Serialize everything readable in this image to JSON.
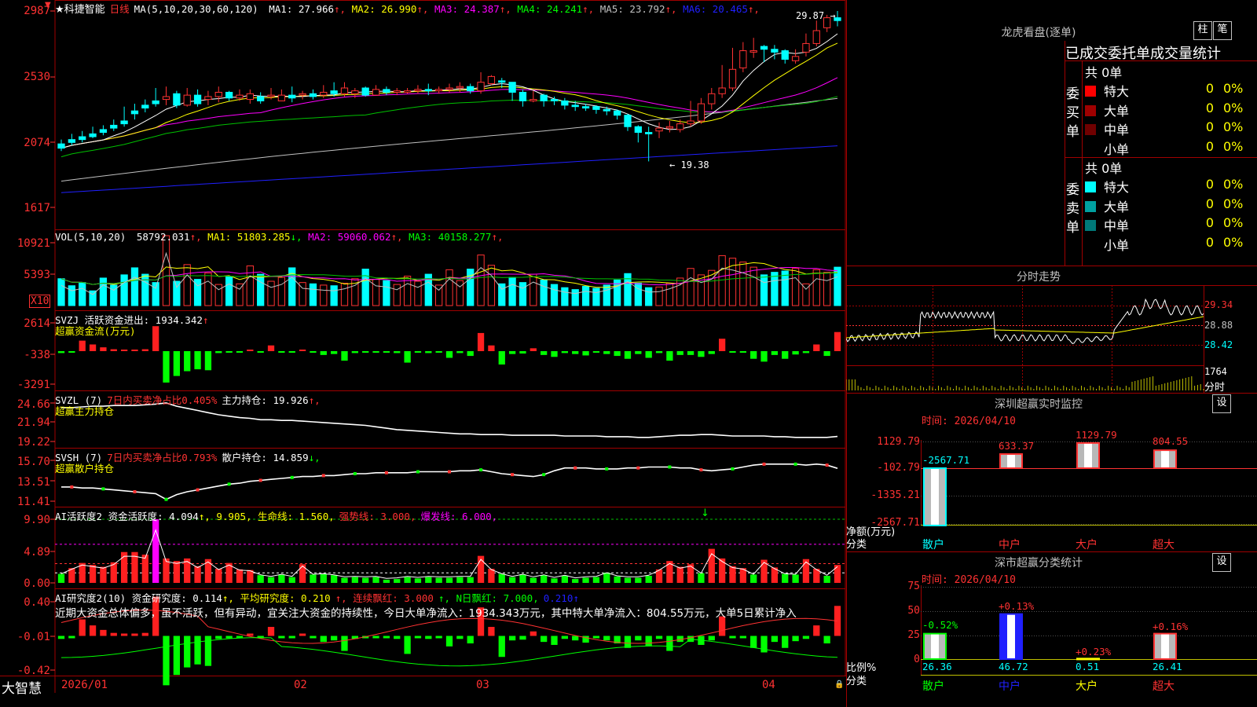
{
  "stock": {
    "name": "★科捷智能",
    "period": "日线",
    "ma_header": "MA(5,10,20,30,60,120)",
    "ma_values": [
      {
        "label": "MA1: 27.966",
        "arrow": "↑",
        "color": "#ffffff"
      },
      {
        "label": "MA2: 26.990",
        "arrow": "↑",
        "color": "#ffff00"
      },
      {
        "label": "MA3: 24.387",
        "arrow": "↑",
        "color": "#ff00ff"
      },
      {
        "label": "MA4: 24.241",
        "arrow": "↑",
        "color": "#00ff00"
      },
      {
        "label": "MA5: 23.792",
        "arrow": "↑",
        "color": "#c0c0c0"
      },
      {
        "label": "MA6: 20.465",
        "arrow": "↑",
        "color": "#2020ff"
      }
    ],
    "price_axis": [
      "2987",
      "2530",
      "2074",
      "1617"
    ],
    "high_marker": "29.87",
    "low_marker": "19.38"
  },
  "volume": {
    "header": "VOL(5,10,20)",
    "values": [
      {
        "label": "58792.031",
        "arrow": "↑",
        "color": "#ffffff"
      },
      {
        "label": "MA1: 51803.285",
        "arrow": "↓",
        "color": "#ffff00"
      },
      {
        "label": "MA2: 59060.062",
        "arrow": "↑",
        "color": "#ff00ff"
      },
      {
        "label": "MA3: 40158.277",
        "arrow": "↑",
        "color": "#00ff00"
      }
    ],
    "axis": [
      "10921",
      "5393"
    ],
    "unit": "X10"
  },
  "svzj": {
    "header": "SVZJ  活跃资金进出: 1934.342",
    "arrow": "↑",
    "sub": "超赢资金流(万元)",
    "axis": [
      "2614",
      "-338",
      "-3291"
    ]
  },
  "svzl": {
    "header": "SVZL (7)",
    "pct": "7日内买卖净占比0.405%",
    "hold": "主力持仓: 19.926",
    "arrow": "↑,",
    "sub": "超赢主力持仓",
    "axis": [
      "24.66",
      "21.94",
      "19.22"
    ]
  },
  "svsh": {
    "header": "SVSH (7)",
    "pct": "7日内买卖净占比0.793%",
    "hold": "散户持仓: 14.859",
    "arrow": "↓,",
    "sub": "超赢散户持仓",
    "axis": [
      "15.70",
      "13.51",
      "11.41"
    ]
  },
  "ai_active": {
    "header": "AI活跃度2 资金活跃度: 4.094",
    "a1": "↑, 9.905, 生命线: 1.560,",
    "strong": "强势线: 3.000,",
    "burst": "爆发线: 6.000,",
    "axis": [
      "9.90",
      "4.89",
      "0.00"
    ]
  },
  "ai_research": {
    "header": "AI研究度2(10) 资金研究度: 0.114",
    "avg": "↑, 平均研究度: 0.210",
    "cont": "↑, 连续飘红: 3.000",
    "nday": "↑, N日飘红: 7.000,",
    "tail": "0.210↑",
    "commentary": "近期大资金总体偏多，虽不活跃，但有异动，宜关注大资金的持续性，今日大单净流入：1934.343万元，其中特大单净流入：804.55万元，大单5日累计净入",
    "axis": [
      "0.40",
      "-0.01",
      "-0.42"
    ]
  },
  "date_axis": [
    "2026/01",
    "02",
    "03",
    "04"
  ],
  "brand": "大智慧",
  "right": {
    "dragon_title": "龙虎看盘(逐单)",
    "btn_bar": "柱",
    "btn_pen": "笔",
    "tabs_text": "已成交委托单成交量统计",
    "buy_label": "委买单",
    "sell_label": "委卖单",
    "buy_total": "共 0单",
    "sell_total": "共 0单",
    "buy_rows": [
      {
        "name": "特大",
        "count": "0",
        "pct": "0%",
        "color": "#ff0000"
      },
      {
        "name": "大单",
        "count": "0",
        "pct": "0%",
        "color": "#a00000"
      },
      {
        "name": "中单",
        "count": "0",
        "pct": "0%",
        "color": "#700000"
      },
      {
        "name": "小单",
        "count": "0",
        "pct": "0%",
        "color": "#000000"
      }
    ],
    "sell_rows": [
      {
        "name": "特大",
        "count": "0",
        "pct": "0%",
        "color": "#00ffff"
      },
      {
        "name": "大单",
        "count": "0",
        "pct": "0%",
        "color": "#00a0a0"
      },
      {
        "name": "中单",
        "count": "0",
        "pct": "0%",
        "color": "#007878"
      },
      {
        "name": "小单",
        "count": "0",
        "pct": "0%",
        "color": "#000000"
      }
    ],
    "minute_title": "分时走势",
    "minute_axis": [
      "29.34",
      "28.88",
      "28.42"
    ],
    "minute_vol": "1764",
    "minute_vol_unit": "分时",
    "monitor_title": "深圳超赢实时监控",
    "monitor_btn": "设",
    "monitor_time": "时间: 2026/04/10",
    "monitor_axis": [
      "1129.79",
      "-102.79",
      "-1335.21",
      "-2567.71"
    ],
    "monitor_unit": "净额(万元)",
    "monitor_cat": "分类",
    "monitor_cats": [
      "散户",
      "中户",
      "大户",
      "超大"
    ],
    "monitor_vals": [
      "-2567.71",
      "633.37",
      "1129.79",
      "804.55"
    ],
    "stat_title": "深市超赢分类统计",
    "stat_btn": "设",
    "stat_time": "时间: 2026/04/10",
    "stat_axis": [
      "75",
      "50",
      "25",
      "0"
    ],
    "stat_unit": "比例%",
    "stat_cat": "分类",
    "stat_cats": [
      "散户",
      "中户",
      "大户",
      "超大"
    ],
    "stat_pcts": [
      "-0.52%",
      "+0.13%",
      "+0.23%",
      "+0.16%"
    ],
    "stat_vals": [
      "26.36",
      "46.72",
      "0.51",
      "26.41"
    ]
  },
  "chart_data": [
    {
      "type": "candlestick",
      "title": "★科捷智能 日线",
      "ylim": [
        16.17,
        29.87
      ],
      "open": [
        20.6,
        20.9,
        21.1,
        21.3,
        21.6,
        21.9,
        22.2,
        22.9,
        23.3,
        23.6,
        23.7,
        24.1,
        23.3,
        24.0,
        23.7,
        23.9,
        24.2,
        23.8,
        23.7,
        23.9,
        23.9,
        23.6,
        24.0,
        24.0,
        24.1,
        24.0,
        24.3,
        24.1,
        24.1,
        24.5,
        24.0,
        24.4,
        24.2,
        24.2,
        24.3,
        24.4,
        24.3,
        24.4,
        24.5,
        24.6,
        24.3,
        24.8,
        25.0,
        24.9,
        24.2,
        23.6,
        24.0,
        23.7,
        23.6,
        23.3,
        23.2,
        23.2,
        23.0,
        22.9,
        22.6,
        21.8,
        21.4,
        21.5,
        21.7,
        21.6,
        22.0,
        22.2,
        23.4,
        24.1,
        24.5,
        25.9,
        27.0,
        27.4,
        27.2,
        27.1,
        26.4,
        27.0,
        27.6,
        28.7,
        29.4
      ],
      "close": [
        20.3,
        20.7,
        20.9,
        21.1,
        21.4,
        21.7,
        22.0,
        22.7,
        23.1,
        23.4,
        23.9,
        23.3,
        24.0,
        23.4,
        23.9,
        24.2,
        23.8,
        24.0,
        24.1,
        23.6,
        24.0,
        24.0,
        23.8,
        24.1,
        23.9,
        24.2,
        24.1,
        24.5,
        24.3,
        24.0,
        24.4,
        24.2,
        24.3,
        24.3,
        24.4,
        24.3,
        24.4,
        24.5,
        24.6,
        24.3,
        24.9,
        25.3,
        24.9,
        24.2,
        23.6,
        23.7,
        23.6,
        23.6,
        23.3,
        23.2,
        23.1,
        23.0,
        22.9,
        22.6,
        21.8,
        21.4,
        21.3,
        21.7,
        21.8,
        22.0,
        22.2,
        23.4,
        24.1,
        24.5,
        25.8,
        27.1,
        27.1,
        27.2,
        27.0,
        26.5,
        26.7,
        27.6,
        28.5,
        29.4,
        29.2
      ],
      "high": [
        20.9,
        21.3,
        21.5,
        21.8,
        21.9,
        22.3,
        23.2,
        23.4,
        23.7,
        24.5,
        24.6,
        24.3,
        24.5,
        24.4,
        24.3,
        24.6,
        24.3,
        24.4,
        24.4,
        24.2,
        24.5,
        24.4,
        24.6,
        24.3,
        24.4,
        24.7,
        24.9,
        24.9,
        24.5,
        24.6,
        24.7,
        24.6,
        24.5,
        24.5,
        24.7,
        24.8,
        24.6,
        24.8,
        24.9,
        24.8,
        25.6,
        25.4,
        25.2,
        24.9,
        24.4,
        24.3,
        24.1,
        23.9,
        23.8,
        23.6,
        23.4,
        23.3,
        23.2,
        23.0,
        22.7,
        21.9,
        21.8,
        22.1,
        22.2,
        22.3,
        23.6,
        23.8,
        24.5,
        26.1,
        27.3,
        27.7,
        28.0,
        27.5,
        27.5,
        27.2,
        27.2,
        28.3,
        29.2,
        29.6,
        29.87
      ],
      "low": [
        20.1,
        20.5,
        20.7,
        21.0,
        21.2,
        21.5,
        21.8,
        22.3,
        22.8,
        23.2,
        23.3,
        23.1,
        23.2,
        23.2,
        23.3,
        23.5,
        23.6,
        23.6,
        23.4,
        23.4,
        23.7,
        23.6,
        23.5,
        23.7,
        23.7,
        23.8,
        23.9,
        23.9,
        23.8,
        23.9,
        24.0,
        24.0,
        24.0,
        24.1,
        24.1,
        24.0,
        24.1,
        24.2,
        24.2,
        24.1,
        24.1,
        24.7,
        24.5,
        23.6,
        23.2,
        23.5,
        23.2,
        23.3,
        23.0,
        22.9,
        22.9,
        22.7,
        22.6,
        22.3,
        21.5,
        20.7,
        19.38,
        21.0,
        21.4,
        21.4,
        21.8,
        22.0,
        23.0,
        23.8,
        24.3,
        25.6,
        26.6,
        26.3,
        26.5,
        26.2,
        26.2,
        26.7,
        27.4,
        28.4,
        28.8
      ]
    },
    {
      "type": "bar",
      "title": "VOL(5,10,20)",
      "values": [
        4200,
        3100,
        3600,
        2300,
        4300,
        3200,
        4800,
        5900,
        4900,
        3600,
        10921,
        3800,
        6400,
        4100,
        5100,
        3300,
        4500,
        3400,
        6200,
        4900,
        3800,
        4400,
        5900,
        3600,
        3400,
        3200,
        3100,
        3500,
        4200,
        5700,
        4100,
        3900,
        3300,
        4600,
        3800,
        4900,
        3200,
        5600,
        3900,
        5700,
        7900,
        6300,
        3400,
        4400,
        3600,
        4900,
        4000,
        3300,
        2800,
        2500,
        3000,
        2700,
        3200,
        4000,
        5000,
        3500,
        2800,
        2900,
        3500,
        4300,
        5800,
        4800,
        5500,
        7800,
        7400,
        6800,
        6000,
        4800,
        5200,
        5400,
        5800,
        3400,
        5600,
        5200,
        6000
      ]
    },
    {
      "type": "bar",
      "title": "SVZJ 活跃资金进出",
      "values": [
        -200,
        -150,
        1100,
        700,
        400,
        200,
        150,
        100,
        200,
        2614,
        -3291,
        -2600,
        -2100,
        -1900,
        -2000,
        -200,
        -100,
        -50,
        100,
        -120,
        600,
        -50,
        -100,
        100,
        -150,
        -400,
        -300,
        -1000,
        -200,
        -150,
        -100,
        -150,
        -200,
        -1200,
        -100,
        -200,
        -150,
        -700,
        -200,
        -500,
        1900,
        600,
        -1400,
        -300,
        -250,
        300,
        -400,
        -600,
        -200,
        -300,
        -450,
        -100,
        -300,
        -500,
        -800,
        -300,
        -700,
        -200,
        -1000,
        -400,
        -400,
        -600,
        -300,
        1300,
        -100,
        -150,
        -800,
        -1100,
        -400,
        -800,
        -350,
        -200,
        700,
        -500,
        2000
      ]
    },
    {
      "type": "line",
      "title": "SVZL 主力持仓",
      "values": [
        24.0,
        24.0,
        24.1,
        24.2,
        24.2,
        24.3,
        24.3,
        24.3,
        24.4,
        24.5,
        24.66,
        24.2,
        23.9,
        23.6,
        23.3,
        23.0,
        22.8,
        22.6,
        22.5,
        22.3,
        22.3,
        22.2,
        22.2,
        22.1,
        22.0,
        21.9,
        21.8,
        21.7,
        21.6,
        21.5,
        21.3,
        21.1,
        20.9,
        20.8,
        20.7,
        20.6,
        20.5,
        20.4,
        20.3,
        20.3,
        20.2,
        20.2,
        20.2,
        20.1,
        20.1,
        20.1,
        20.1,
        20.1,
        20.0,
        20.0,
        20.0,
        20.0,
        19.9,
        19.9,
        19.9,
        19.8,
        19.8,
        19.9,
        20.0,
        20.1,
        20.1,
        20.2,
        20.2,
        20.1,
        20.0,
        20.0,
        20.0,
        20.0,
        19.9,
        19.9,
        19.8,
        19.8,
        19.8,
        19.8,
        19.926
      ]
    },
    {
      "type": "line",
      "title": "SVSH 散户持仓",
      "values": [
        12.9,
        12.9,
        12.8,
        12.8,
        12.7,
        12.6,
        12.5,
        12.4,
        12.3,
        12.2,
        11.6,
        12.1,
        12.4,
        12.6,
        12.8,
        13.0,
        13.2,
        13.3,
        13.5,
        13.6,
        13.7,
        13.8,
        13.9,
        14.0,
        14.0,
        14.1,
        14.1,
        14.2,
        14.3,
        14.3,
        14.4,
        14.4,
        14.4,
        14.4,
        14.5,
        14.5,
        14.5,
        14.5,
        14.6,
        14.6,
        14.7,
        14.5,
        14.3,
        14.2,
        14.1,
        14.0,
        14.2,
        14.6,
        14.9,
        14.9,
        14.9,
        14.8,
        14.8,
        14.8,
        14.9,
        14.9,
        15.0,
        15.0,
        15.0,
        14.9,
        14.9,
        14.7,
        14.6,
        14.7,
        14.8,
        15.0,
        15.2,
        15.3,
        15.3,
        15.3,
        15.3,
        15.2,
        15.3,
        15.2,
        14.859
      ]
    },
    {
      "type": "bar",
      "title": "AI活跃度2 资金活跃度",
      "values": [
        1.4,
        2.3,
        3.1,
        2.8,
        2.5,
        3.2,
        4.8,
        4.8,
        4.4,
        9.9,
        3.8,
        3.4,
        3.8,
        2.6,
        3.7,
        2.2,
        3.1,
        2.1,
        2.0,
        1.2,
        0.9,
        1.3,
        0.9,
        2.9,
        1.3,
        1.4,
        1.2,
        0.8,
        0.9,
        0.8,
        0.9,
        0.5,
        0.6,
        0.9,
        0.7,
        0.9,
        0.8,
        0.8,
        0.9,
        0.9,
        4.2,
        2.2,
        1.4,
        0.9,
        1.3,
        0.8,
        1.2,
        0.7,
        1.1,
        0.6,
        0.8,
        0.9,
        1.6,
        1.0,
        0.8,
        0.8,
        1.1,
        2.1,
        3.4,
        2.5,
        2.9,
        1.5,
        5.3,
        3.8,
        2.6,
        2.3,
        1.3,
        3.6,
        2.4,
        1.4,
        1.3,
        3.7,
        2.2,
        1.1,
        2.8
      ]
    }
  ]
}
